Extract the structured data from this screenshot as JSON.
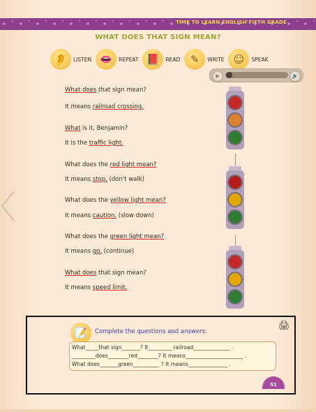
{
  "header": {
    "banner_text": "TIME TO LEARN ENGLISH FIFTH GRADE"
  },
  "title": "WHAT DOES THAT SIGN MEAN?",
  "skills": [
    {
      "label": "LISTEN",
      "icon": "ear-icon"
    },
    {
      "label": "REPEAT",
      "icon": "mouth-icon"
    },
    {
      "label": "READ",
      "icon": "book-icon"
    },
    {
      "label": "WRITE",
      "icon": "pencil-icon"
    },
    {
      "label": "SPEAK",
      "icon": "speaking-kids-icon"
    }
  ],
  "player": {
    "play": "▶",
    "sound": "🔊"
  },
  "dialogue": [
    {
      "pre": "",
      "u1": "What does",
      "mid": " that sign mean?",
      "u2": "",
      "post": ""
    },
    {
      "pre": "It means ",
      "u1": "railroad crossing.",
      "mid": "",
      "u2": "",
      "post": ""
    },
    {
      "pre": "",
      "u1": "What",
      "mid": " is it, Benjamin?",
      "u2": "",
      "post": ""
    },
    {
      "pre": "It is the ",
      "u1": "traffic light.",
      "mid": "",
      "u2": "",
      "post": ""
    },
    {
      "pre": "What does the ",
      "u1": "red light mean?",
      "mid": "",
      "u2": "",
      "post": ""
    },
    {
      "pre": "It means ",
      "u1": "stop.",
      "mid": " (don't walk)",
      "u2": "",
      "post": ""
    },
    {
      "pre": "What does the ",
      "u1": "yellow light mean?",
      "mid": "",
      "u2": "",
      "post": ""
    },
    {
      "pre": "It means ",
      "u1": "caution.",
      "mid": " (slow down)",
      "u2": "",
      "post": ""
    },
    {
      "pre": "What does the ",
      "u1": "green light mean?",
      "mid": "",
      "u2": "",
      "post": ""
    },
    {
      "pre": "It means ",
      "u1": "go.",
      "mid": " (continue)",
      "u2": "",
      "post": ""
    },
    {
      "pre": "",
      "u1": "What does",
      "mid": " that sign mean?",
      "u2": "",
      "post": ""
    },
    {
      "pre": "It means ",
      "u1": "speed limit.",
      "mid": "",
      "u2": "",
      "post": ""
    }
  ],
  "traffic_light_colors": {
    "red": "#c62828",
    "yellow": "#e0a800",
    "green": "#2e7d32",
    "orange": "#d9822b"
  },
  "exercise": {
    "instruction": "Complete the questions and answers:",
    "line1": "What_____that sign_______?        It_________ railroad______________ .",
    "line2": "_________does________red________?  It means______________________ .",
    "line3": "What does_______green__________          ? It means_______________ ."
  },
  "page_number": "51"
}
